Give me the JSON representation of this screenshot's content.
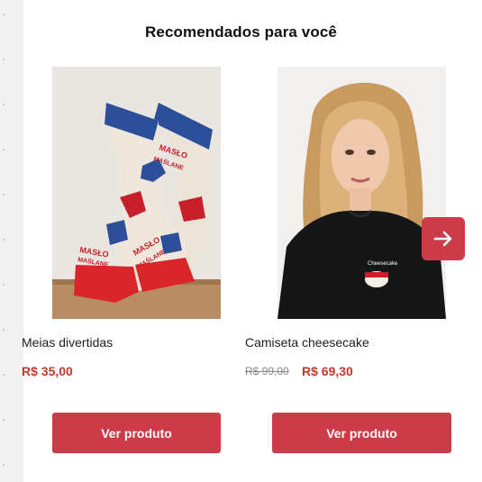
{
  "section": {
    "title": "Recomendados para você"
  },
  "products": [
    {
      "name": "Meias divertidas",
      "price": "R$ 35,00",
      "old_price": "",
      "button_label": "Ver produto",
      "image": "socks-photo"
    },
    {
      "name": "Camiseta cheesecake",
      "price": "R$ 69,30",
      "old_price": "R$ 99,00",
      "button_label": "Ver produto",
      "image": "tshirt-photo"
    }
  ],
  "carousel": {
    "next_icon": "arrow-right-icon"
  },
  "image_text": {
    "sock_text_a": "MASŁO",
    "sock_text_b": "MAŚLANE",
    "shirt_text": "Cheesecake"
  },
  "colors": {
    "accent": "#cc3b48",
    "price": "#c0392b",
    "strip": "#f1f1f1"
  }
}
